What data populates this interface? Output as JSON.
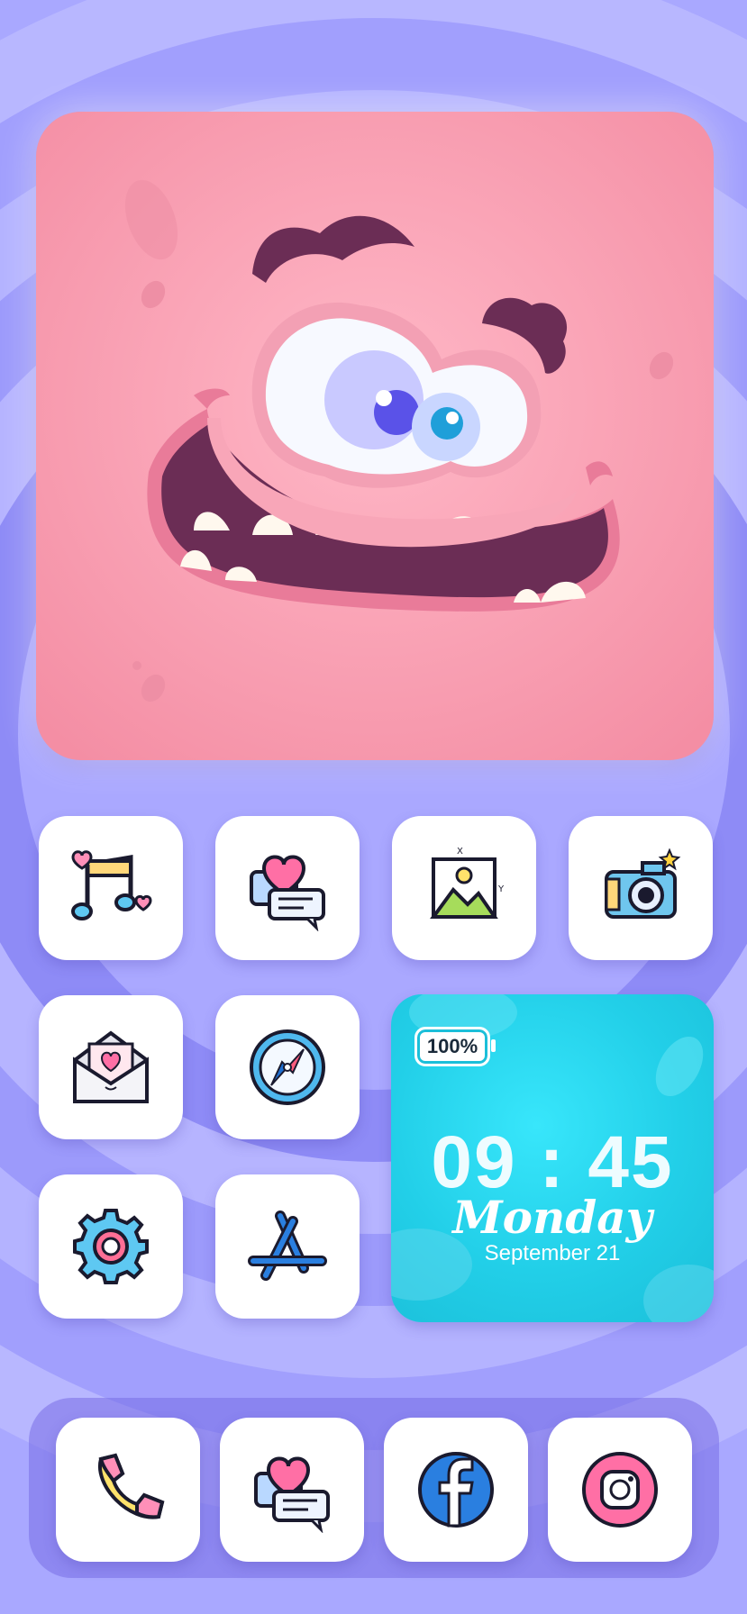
{
  "wallpaper": {
    "color_outer": "#a9a8ff",
    "color_mid": "#8f8cf7",
    "color_inner": "#bdbcff"
  },
  "monster_widget": {
    "skin": "#f9a3b6",
    "mouth": "#6b2d55"
  },
  "apps": [
    {
      "icon": "music-notes-icon"
    },
    {
      "icon": "love-message-icon"
    },
    {
      "icon": "gallery-icon"
    },
    {
      "icon": "camera-icon"
    },
    {
      "icon": "love-letter-icon"
    },
    {
      "icon": "compass-icon"
    },
    {
      "icon": "settings-gear-icon"
    },
    {
      "icon": "app-store-icon"
    }
  ],
  "clock_widget": {
    "battery": "100%",
    "time": "09 : 45",
    "day": "Monday",
    "date": "September 21",
    "color": "#22cfe8"
  },
  "dock": [
    {
      "icon": "phone-icon"
    },
    {
      "icon": "love-message-icon"
    },
    {
      "icon": "facebook-icon"
    },
    {
      "icon": "instagram-icon"
    }
  ]
}
